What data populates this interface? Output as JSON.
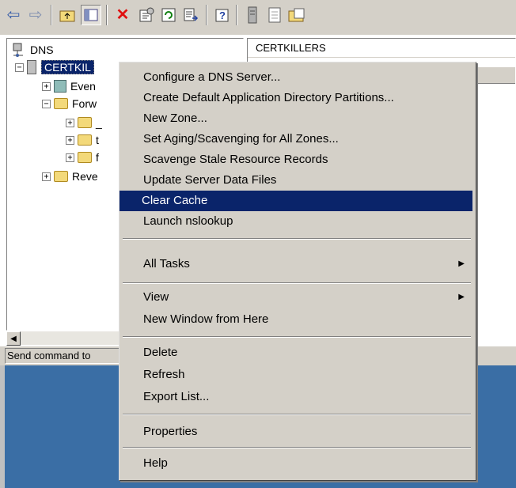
{
  "toolbar": {
    "icons": [
      "back-arrow-icon",
      "forward-arrow-icon",
      "up-one-level-icon",
      "show-hide-console-tree-icon",
      "delete-icon",
      "properties-icon",
      "refresh-icon",
      "export-list-icon",
      "help-icon",
      "server-icon",
      "document-icon",
      "folder-icon"
    ]
  },
  "tree": {
    "root_label": "DNS",
    "server_label": "CERTKIL",
    "event_viewer_label": "Even",
    "forward_zones_label": "Forw",
    "zone_item_1": "_",
    "zone_item_2": "t",
    "zone_item_3": "f",
    "reverse_zones_label": "Reve"
  },
  "right_pane": {
    "header_label": "CERTKILLERS"
  },
  "status": {
    "text": "Send command to"
  },
  "context_menu": {
    "items": [
      {
        "label": "Configure a DNS Server..."
      },
      {
        "label": "Create Default Application Directory Partitions..."
      },
      {
        "label": "New Zone..."
      },
      {
        "label": "Set Aging/Scavenging for All Zones..."
      },
      {
        "label": "Scavenge Stale Resource Records"
      },
      {
        "label": "Update Server Data Files"
      },
      {
        "label": "Clear Cache",
        "selected": true
      },
      {
        "label": "Launch nslookup"
      },
      {
        "label": "All Tasks",
        "submenu": true
      },
      {
        "label": "View",
        "submenu": true
      },
      {
        "label": "New Window from Here"
      },
      {
        "label": "Delete"
      },
      {
        "label": "Refresh"
      },
      {
        "label": "Export List..."
      },
      {
        "label": "Properties"
      },
      {
        "label": "Help"
      }
    ]
  },
  "colors": {
    "selection": "#0a246a",
    "face": "#d4d0c8",
    "desktop": "#3a6ea5"
  }
}
